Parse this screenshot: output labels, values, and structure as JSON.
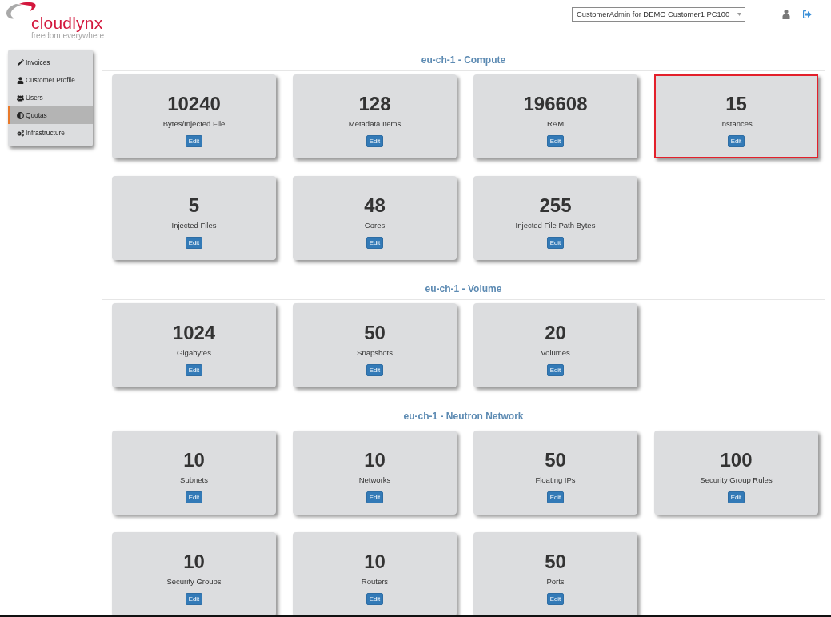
{
  "header": {
    "logo_name": "cloudlynx",
    "logo_tagline": "freedom everywhere",
    "account_select": {
      "value": "CustomerAdmin for DEMO Customer1 PC100"
    }
  },
  "sidebar": {
    "items": [
      {
        "label": "Invoices",
        "selected": false
      },
      {
        "label": "Customer Profile",
        "selected": false
      },
      {
        "label": "Users",
        "selected": false
      },
      {
        "label": "Quotas",
        "selected": true
      },
      {
        "label": "Infrastructure",
        "selected": false
      }
    ]
  },
  "sections": [
    {
      "title": "eu-ch-1 - Compute",
      "quotas": [
        {
          "value": "10240",
          "label": "Bytes/Injected File",
          "button": "Edit",
          "highlighted": false
        },
        {
          "value": "128",
          "label": "Metadata Items",
          "button": "Edit",
          "highlighted": false
        },
        {
          "value": "196608",
          "label": "RAM",
          "button": "Edit",
          "highlighted": false
        },
        {
          "value": "15",
          "label": "Instances",
          "button": "Edit",
          "highlighted": true
        },
        {
          "value": "5",
          "label": "Injected Files",
          "button": "Edit",
          "highlighted": false
        },
        {
          "value": "48",
          "label": "Cores",
          "button": "Edit",
          "highlighted": false
        },
        {
          "value": "255",
          "label": "Injected File Path Bytes",
          "button": "Edit",
          "highlighted": false
        }
      ]
    },
    {
      "title": "eu-ch-1 - Volume",
      "quotas": [
        {
          "value": "1024",
          "label": "Gigabytes",
          "button": "Edit",
          "highlighted": false
        },
        {
          "value": "50",
          "label": "Snapshots",
          "button": "Edit",
          "highlighted": false
        },
        {
          "value": "20",
          "label": "Volumes",
          "button": "Edit",
          "highlighted": false
        }
      ]
    },
    {
      "title": "eu-ch-1 - Neutron Network",
      "quotas": [
        {
          "value": "10",
          "label": "Subnets",
          "button": "Edit",
          "highlighted": false
        },
        {
          "value": "10",
          "label": "Networks",
          "button": "Edit",
          "highlighted": false
        },
        {
          "value": "50",
          "label": "Floating IPs",
          "button": "Edit",
          "highlighted": false
        },
        {
          "value": "100",
          "label": "Security Group Rules",
          "button": "Edit",
          "highlighted": false
        },
        {
          "value": "10",
          "label": "Security Groups",
          "button": "Edit",
          "highlighted": false
        },
        {
          "value": "10",
          "label": "Routers",
          "button": "Edit",
          "highlighted": false
        },
        {
          "value": "50",
          "label": "Ports",
          "button": "Edit",
          "highlighted": false
        }
      ]
    }
  ]
}
